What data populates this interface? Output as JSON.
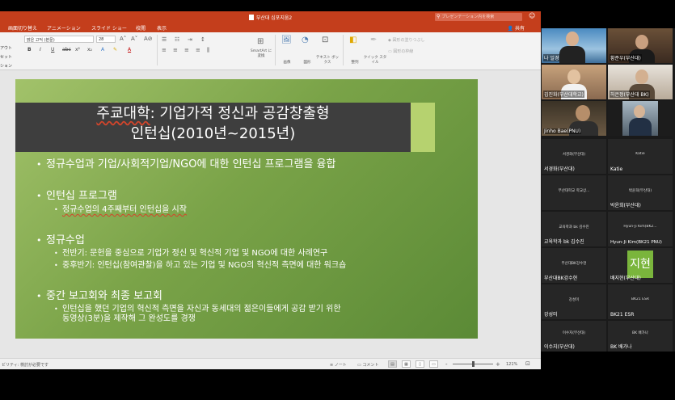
{
  "ppt": {
    "title": "부산대 심포지움2",
    "search_placeholder": "プレゼンテーション内を検索",
    "menu": [
      "画面切り替え",
      "アニメーション",
      "スライド ショー",
      "校閲",
      "表示"
    ],
    "share_label": "共有",
    "ribbon": {
      "left_cut": [
        "アウト",
        "セット",
        "ション"
      ],
      "font_name": "맑은 고딕 (본문)",
      "font_size": "28",
      "format_buttons": [
        "B",
        "I",
        "U",
        "abc",
        "x²",
        "x₂"
      ],
      "smartart_label": "SmartArt\nに変換",
      "image_label": "画像",
      "shape_label": "図形",
      "textbox_label": "テキスト\nボックス",
      "arrange_label": "整列",
      "quickstyle_label": "クイック\nスタイル",
      "shape_fill_label": "図形の塗りつぶし",
      "shape_outline_label": "図形の枠線"
    },
    "status": {
      "accessibility": "ビリティ: 検討が必要です",
      "notes": "ノート",
      "comments": "コメント",
      "zoom": "121%",
      "zoom_zoomout": "-",
      "zoom_zoomin": "+"
    }
  },
  "slide": {
    "title_part1": "주쿄대학",
    "title_part2": ": 기업가적 정신과 공감창출형",
    "title_line2": "인턴십(2010년~2015년)",
    "bullets": [
      {
        "text": "정규수업과 기업/사회적기업/NGO에 대한 인턴십 프로그램을 융합",
        "subs": []
      },
      {
        "text": "인턴십 프로그램",
        "subs": [
          "정규수업의 4주째부터 인턴십을 시작"
        ]
      },
      {
        "text": "정규수업",
        "subs": [
          "전반기: 문헌을 중심으로 기업가 정신 및 혁신적 기업 및 NGO에 대한 사례연구",
          "중후반기: 인턴십(참여관찰)을 하고 있는 기업 및 NGO의 혁신적 측면에 대한 워크숍"
        ]
      },
      {
        "text": "중간 보고회와 최종 보고회",
        "subs": [
          "인턴십을 했던 기업의 혁신적 측면을 자신과 동세대의 젊은이들에게 공감 받기 위한",
          "동영상(3분)을 제작해 그 완성도를 경쟁"
        ]
      }
    ],
    "bullet_symbol": "•"
  },
  "zoom": {
    "participants": [
      {
        "name": "나 일경",
        "center": ""
      },
      {
        "name": "황준우(부산대)",
        "center": ""
      },
      {
        "name": "김진화(부산대학교)",
        "center": ""
      },
      {
        "name": "허은정(부산대 BK)",
        "center": ""
      },
      {
        "name": "Jinho Bae(PNU)",
        "center": ""
      },
      {
        "name": "",
        "center": ""
      },
      {
        "name": "서경화(부산대)",
        "center": "서경화(부산대)"
      },
      {
        "name": "Katie",
        "center": "Katie"
      },
      {
        "name": "",
        "center": "부산대학교 학교상..."
      },
      {
        "name": "박윤희(부산대)",
        "center": "박윤희(부산대)"
      },
      {
        "name": "교육학과 bk 김수진",
        "center": "교육학과 bk 김수진"
      },
      {
        "name": "Hyun-Ji Kim(BK21 PNU)",
        "center": "Hyun-Ji Kim(BK2..."
      },
      {
        "name": "부산대BK강수현",
        "center": "부산대BK강수현"
      },
      {
        "name": "배지현(부산대)",
        "center": "",
        "initials": "지현"
      },
      {
        "name": "강성미",
        "center": "강성미"
      },
      {
        "name": "BK21 ESR",
        "center": "BK21 ESR"
      },
      {
        "name": "이수지(부산대)",
        "center": "이수지(부산대)"
      },
      {
        "name": "BK 배가나",
        "center": "BK 배가나"
      }
    ]
  },
  "colors": {
    "ppt_accent": "#c43e1c",
    "slide_title_bg": "#3e3e3e",
    "slide_accent": "#b6d26f",
    "slide_green": "#7aa348",
    "avatar_green": "#7ab53c"
  }
}
